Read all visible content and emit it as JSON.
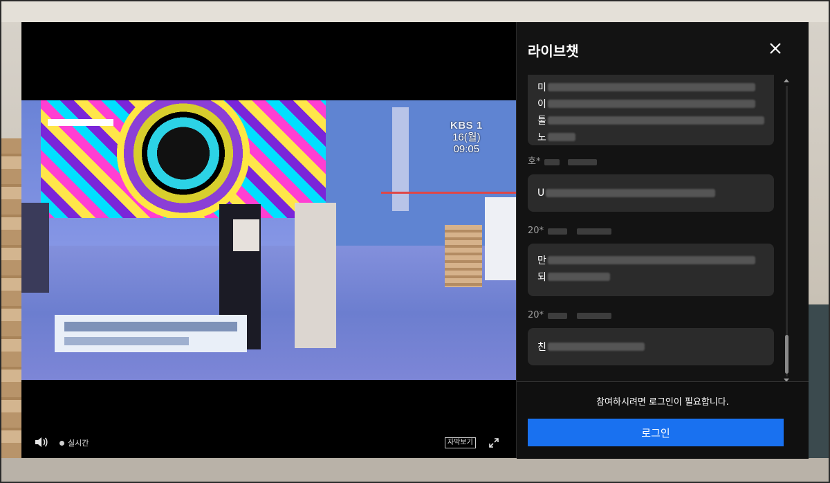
{
  "chat": {
    "title": "라이브챗",
    "messages": [
      {
        "user": "",
        "lines": [
          "미",
          "이",
          "툴",
          "노"
        ]
      },
      {
        "user": "호*",
        "lines": [
          "U"
        ]
      },
      {
        "user": "20*",
        "lines": [
          "만",
          "되"
        ]
      },
      {
        "user": "20*",
        "lines": [
          "친"
        ]
      }
    ],
    "login_notice": "참여하시려면 로그인이 필요합니다.",
    "login_button": "로그인"
  },
  "video": {
    "overlay_logo": "KBS 1",
    "overlay_date": "16(월)",
    "overlay_time": "09:05",
    "live_label": "실시간",
    "subtitle_button": "자막보기"
  },
  "icons": {
    "close": "close-icon",
    "volume": "volume-icon",
    "fullscreen": "fullscreen-icon",
    "live": "live-dot-icon"
  },
  "colors": {
    "accent": "#1971f0",
    "chat_bg": "#131313",
    "bubble_bg": "#2b2b2b"
  }
}
